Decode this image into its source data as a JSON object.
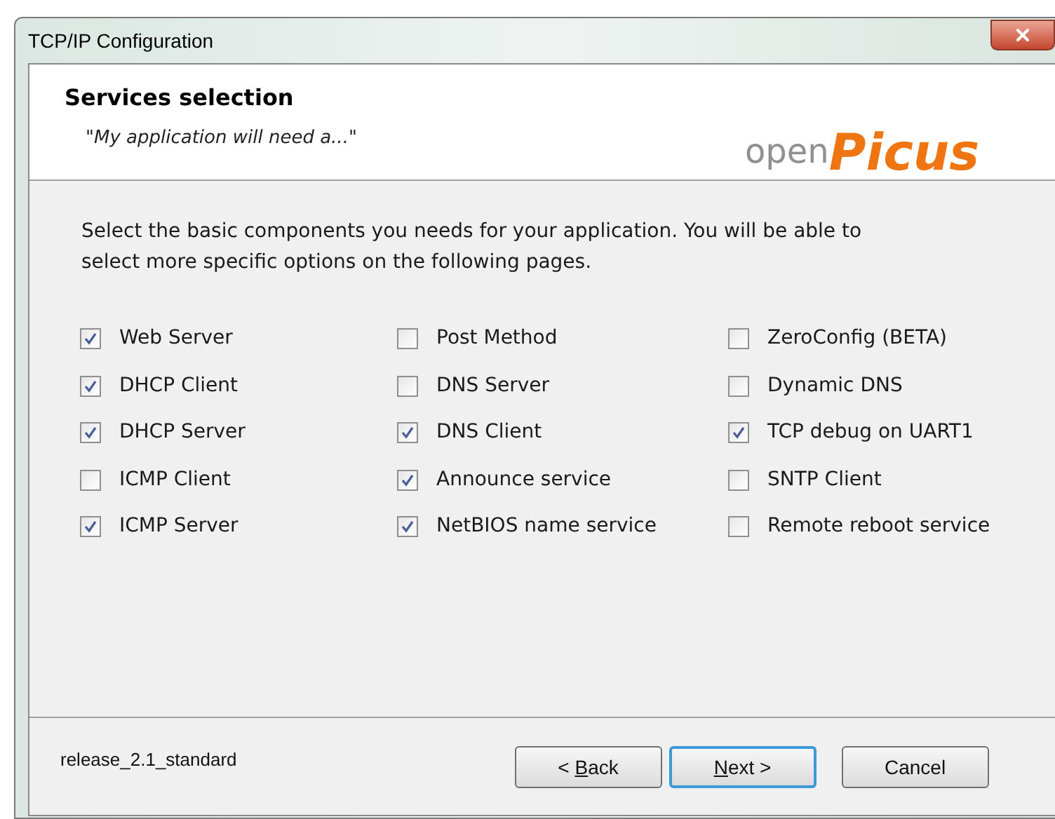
{
  "window": {
    "title": "TCP/IP Configuration"
  },
  "header": {
    "title": "Services selection",
    "subtitle": "\"My application will need a...\"",
    "logo": {
      "part_1": "open",
      "part_2": "Picus"
    }
  },
  "intro": "Select the basic components you needs for your application.  You will be able to select more specific options on the following pages.",
  "columns": [
    {
      "options": [
        {
          "label": "Web Server",
          "checked": true
        },
        {
          "label": "DHCP Client",
          "checked": true
        },
        {
          "label": "DHCP Server",
          "checked": true
        },
        {
          "label": "ICMP Client",
          "checked": false
        },
        {
          "label": "ICMP Server",
          "checked": true
        }
      ]
    },
    {
      "options": [
        {
          "label": "Post Method",
          "checked": false
        },
        {
          "label": "DNS Server",
          "checked": false
        },
        {
          "label": "DNS Client",
          "checked": true
        },
        {
          "label": "Announce service",
          "checked": true
        },
        {
          "label": "NetBIOS name service",
          "checked": true
        }
      ]
    },
    {
      "options": [
        {
          "label": "ZeroConfig (BETA)",
          "checked": false
        },
        {
          "label": "Dynamic DNS",
          "checked": false
        },
        {
          "label": "TCP debug on UART1",
          "checked": true
        },
        {
          "label": "SNTP Client",
          "checked": false
        },
        {
          "label": "Remote reboot service",
          "checked": false
        }
      ]
    }
  ],
  "footer": {
    "version": "release_2.1_standard"
  },
  "buttons": [
    {
      "kind": "back",
      "before": "< ",
      "key": "B",
      "after": "ack",
      "default": false
    },
    {
      "kind": "next",
      "key": "N",
      "after": "ext >",
      "default": true
    },
    {
      "kind": "cancel",
      "before": "Cancel",
      "default": false
    }
  ]
}
